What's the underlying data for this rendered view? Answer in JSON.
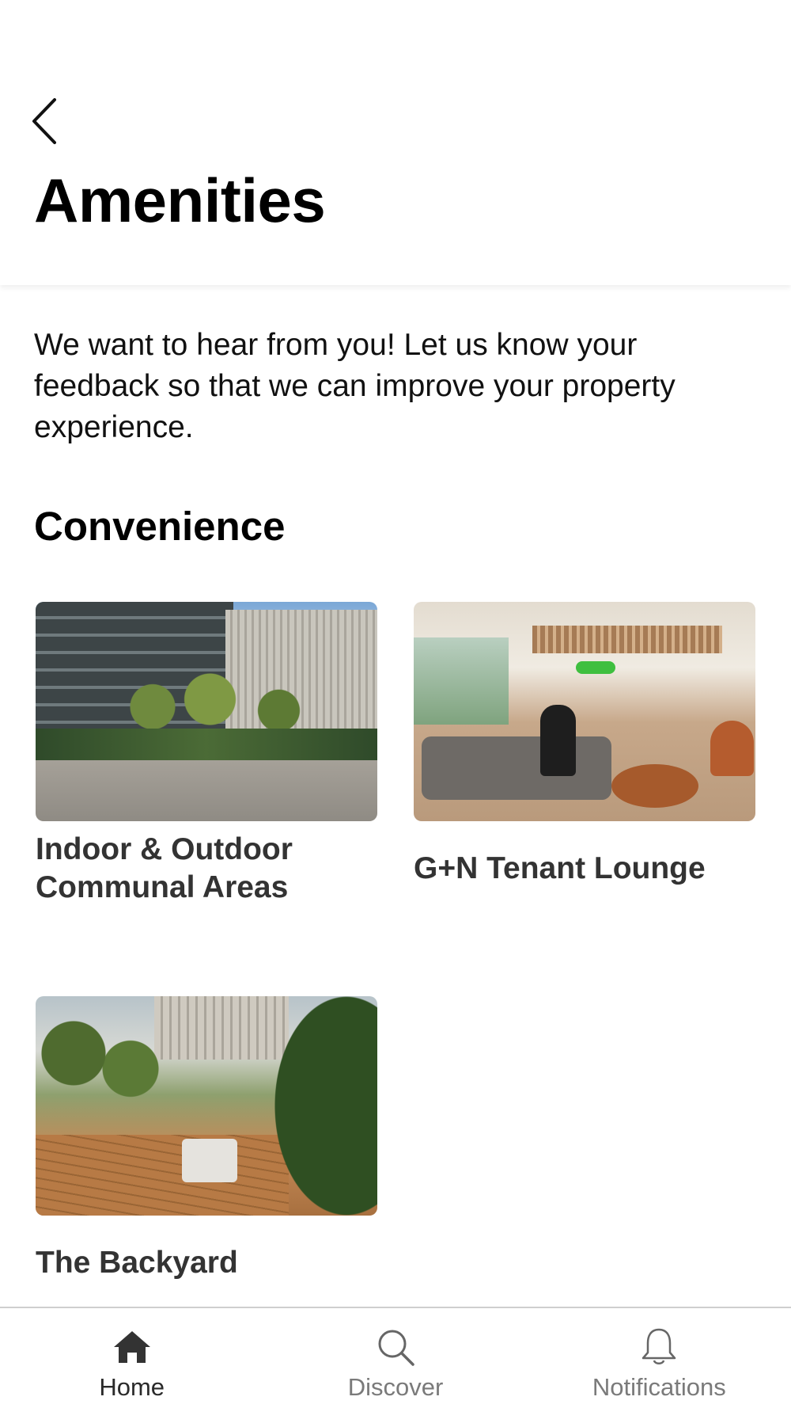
{
  "header": {
    "back_icon": "chevron-left-icon",
    "title": "Amenities"
  },
  "intro": {
    "text": "We want to hear from you! Let us know your feedback so that we can improve your property experience."
  },
  "section": {
    "title": "Convenience"
  },
  "cards": [
    {
      "label": "Indoor & Outdoor Communal Areas",
      "image": "courtyard-photo"
    },
    {
      "label": "G+N Tenant Lounge",
      "image": "lounge-photo"
    },
    {
      "label": "The Backyard",
      "image": "backyard-photo"
    }
  ],
  "tabbar": {
    "items": [
      {
        "label": "Home",
        "icon": "home-icon",
        "active": true
      },
      {
        "label": "Discover",
        "icon": "search-icon",
        "active": false
      },
      {
        "label": "Notifications",
        "icon": "bell-icon",
        "active": false
      }
    ]
  },
  "colors": {
    "active_tab": "#2a2a2a",
    "inactive_tab": "#7a7a7a",
    "divider": "#cfcfcf"
  }
}
